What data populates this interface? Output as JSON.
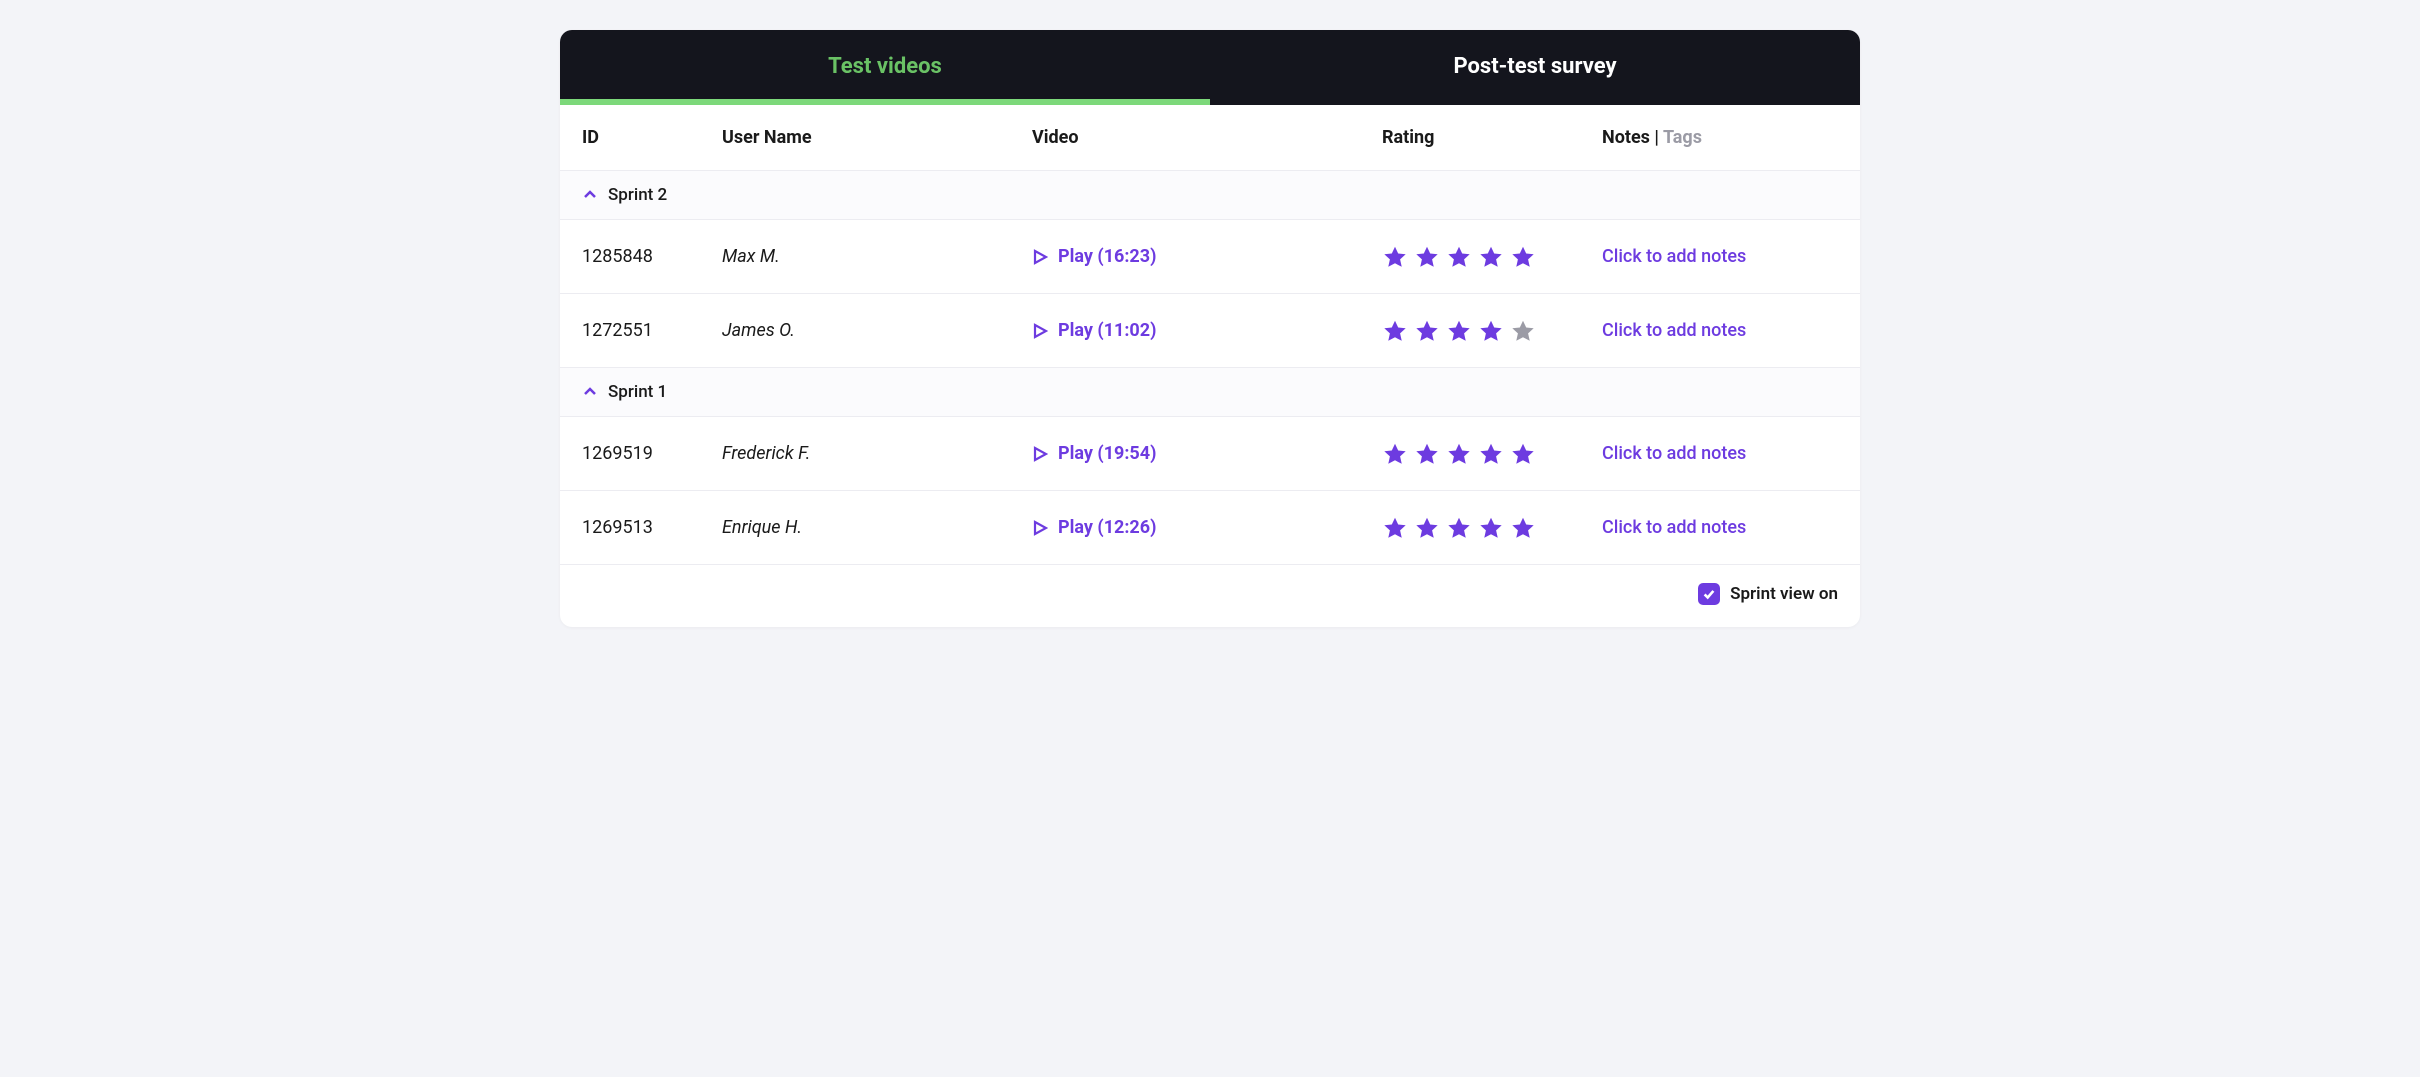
{
  "tabs": [
    {
      "label": "Test videos",
      "active": true
    },
    {
      "label": "Post-test survey",
      "active": false
    }
  ],
  "columns": {
    "id": "ID",
    "user": "User Name",
    "video": "Video",
    "rating": "Rating",
    "notes": "Notes",
    "notes_sep": "|",
    "tags": "Tags"
  },
  "groups": [
    {
      "name": "Sprint 2",
      "rows": [
        {
          "id": "1285848",
          "user": "Max M.",
          "play": "Play (16:23)",
          "rating": 5,
          "notes": "Click to add notes"
        },
        {
          "id": "1272551",
          "user": "James O.",
          "play": "Play (11:02)",
          "rating": 4,
          "notes": "Click to add notes"
        }
      ]
    },
    {
      "name": "Sprint 1",
      "rows": [
        {
          "id": "1269519",
          "user": "Frederick F.",
          "play": "Play (19:54)",
          "rating": 5,
          "notes": "Click to add notes"
        },
        {
          "id": "1269513",
          "user": "Enrique H.",
          "play": "Play (12:26)",
          "rating": 5,
          "notes": "Click to add notes"
        }
      ]
    }
  ],
  "footer": {
    "sprint_view_label": "Sprint view on",
    "sprint_view_checked": true
  }
}
